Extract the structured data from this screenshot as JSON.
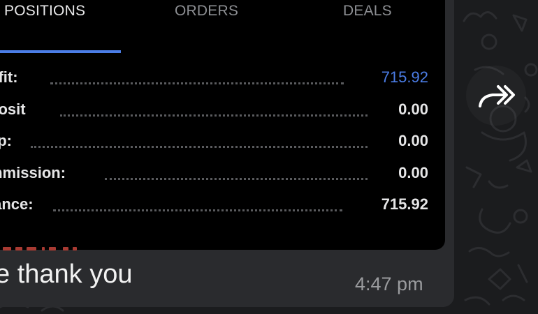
{
  "tabs": {
    "positions": "POSITIONS",
    "orders": "ORDERS",
    "deals": "DEALS"
  },
  "summary": [
    {
      "label": "ofit:",
      "value": "715.92",
      "accent": true
    },
    {
      "label": "posit",
      "value": "0.00",
      "accent": false
    },
    {
      "label": "ap:",
      "value": "0.00",
      "accent": false
    },
    {
      "label": "mmission:",
      "value": "0.00",
      "accent": false
    },
    {
      "label": "lance:",
      "value": "715.92",
      "accent": false
    }
  ],
  "message": {
    "text": "ye thank you",
    "time": "4:47 pm"
  },
  "colors": {
    "accent": "#4b7de6",
    "bubble": "#2a2b2e",
    "background": "#1b1c1e"
  },
  "icons": {
    "forward": "double-forward-arrow-icon"
  }
}
